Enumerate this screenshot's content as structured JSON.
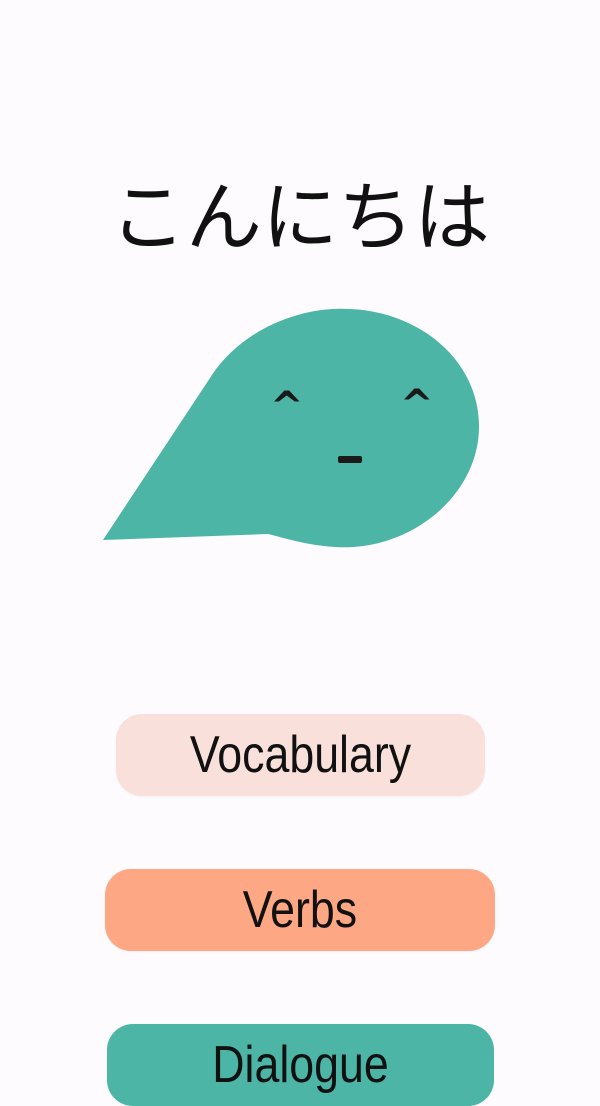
{
  "greeting": "こんにちは",
  "mascot": {
    "icon": "speech-bubble-face-icon",
    "color": "#4cb5a6",
    "left_eye": "^",
    "right_eye": "^",
    "mouth_color": "#1a1a1a"
  },
  "menu": {
    "vocabulary_label": "Vocabulary",
    "verbs_label": "Verbs",
    "dialogue_label": "Dialogue"
  },
  "colors": {
    "background": "#fdfbfd",
    "vocabulary_button": "#f9e0da",
    "verbs_button": "#fea784",
    "dialogue_button": "#4cb5a6"
  }
}
